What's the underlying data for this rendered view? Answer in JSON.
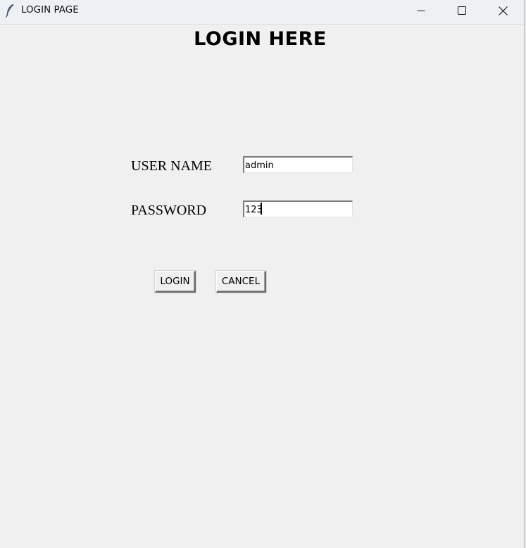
{
  "window": {
    "title": "LOGIN PAGE"
  },
  "form": {
    "heading": "LOGIN HERE",
    "username_label": "USER NAME",
    "username_value": "admin",
    "password_label": "PASSWORD",
    "password_value": "123"
  },
  "buttons": {
    "login": "LOGIN",
    "cancel": "CANCEL"
  },
  "icons": {
    "app": "feather-icon",
    "minimize": "minimize-icon",
    "maximize": "maximize-icon",
    "close": "close-icon"
  },
  "colors": {
    "window_background": "#f0f0f0",
    "titlebar_background": "#eef1f4",
    "entry_background": "#ffffff"
  }
}
